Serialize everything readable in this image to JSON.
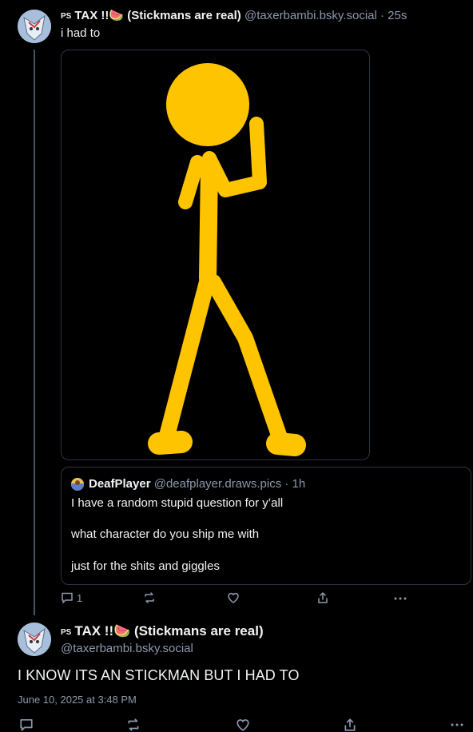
{
  "reply_post": {
    "author_prefix": "PS",
    "display_name": "TAX !!🍉 (Stickmans are real)",
    "handle": "@taxerbambi.bsky.social",
    "time": "· 25s",
    "text": "i had to",
    "image_subject": "yellow-stickman",
    "image_color": "#ffc400",
    "quote": {
      "display_name": "DeafPlayer",
      "handle": "@deafplayer.draws.pics",
      "time": "· 1h",
      "lines": [
        "I have a random stupid question for y’all",
        "what character do you ship me with",
        "just for the shits and giggles"
      ]
    },
    "actions": {
      "reply_count": "1"
    }
  },
  "main_post": {
    "author_prefix": "PS",
    "display_name": "TAX !!🍉 (Stickmans are real)",
    "handle": "@taxerbambi.bsky.social",
    "text": "I KNOW ITS AN STICKMAN BUT I HAD TO",
    "date": "June 10, 2025 at 3:48 PM"
  },
  "colors": {
    "background": "#000000",
    "muted": "#8d99ae",
    "border": "#2e3540",
    "stickman": "#ffc400"
  }
}
